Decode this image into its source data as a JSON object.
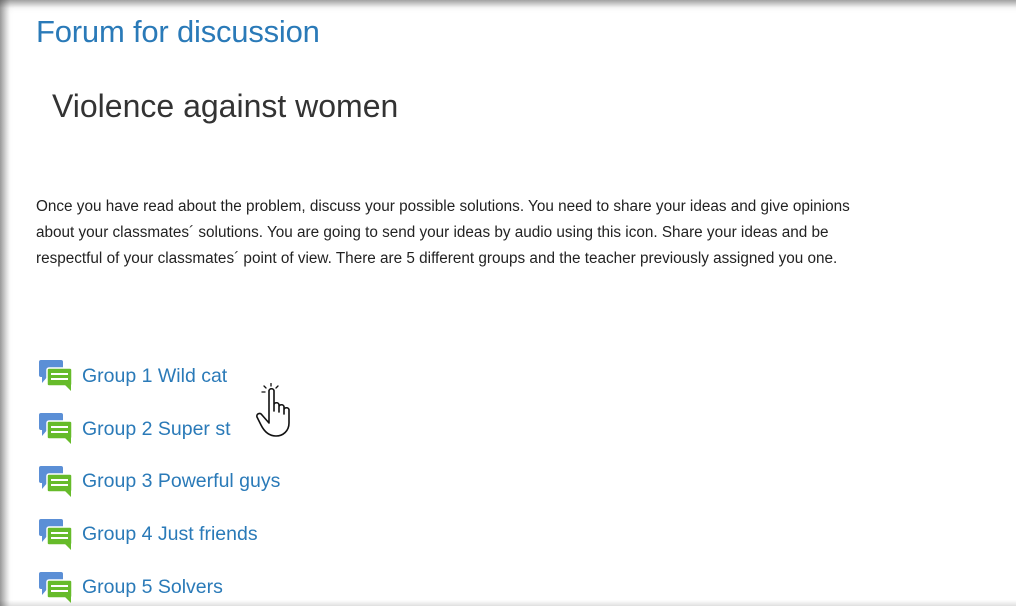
{
  "page_title": "Forum for discussion",
  "forum": {
    "heading": "Violence against women",
    "intro_lines": [
      "Once you have read about the problem, discuss your possible solutions. You need to share your ideas and give opinions",
      "about your classmates´ solutions. You are going to send your ideas by audio using this icon. Share your ideas and be",
      "respectful of your classmates´ point of view. There are 5 different groups and the teacher previously assigned you one."
    ]
  },
  "groups": [
    {
      "label": "Group 1 Wild cat",
      "icon": "forum-discussion-icon"
    },
    {
      "label": "Group 2 Super st",
      "icon": "forum-discussion-icon"
    },
    {
      "label": "Group 3 Powerful guys",
      "icon": "forum-discussion-icon"
    },
    {
      "label": "Group 4 Just friends",
      "icon": "forum-discussion-icon"
    },
    {
      "label": "Group 5 Solvers",
      "icon": "forum-discussion-icon"
    }
  ],
  "cursor": {
    "icon": "hand-pointer-icon"
  },
  "colors": {
    "link": "#2a7ab8",
    "heading": "#333333",
    "text": "#222222",
    "icon_blue": "#5b8fd6",
    "icon_green": "#66bb2a"
  }
}
